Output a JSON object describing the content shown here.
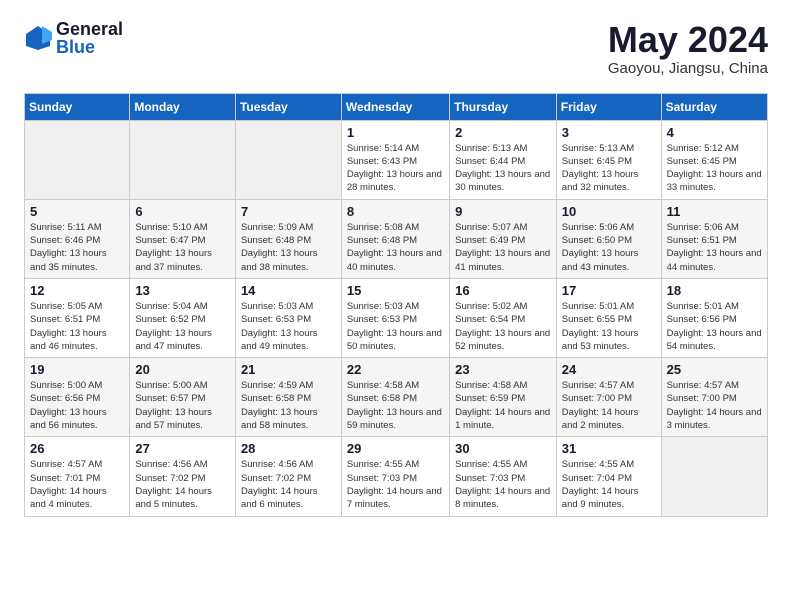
{
  "logo": {
    "general": "General",
    "blue": "Blue"
  },
  "title": "May 2024",
  "location": "Gaoyou, Jiangsu, China",
  "days_of_week": [
    "Sunday",
    "Monday",
    "Tuesday",
    "Wednesday",
    "Thursday",
    "Friday",
    "Saturday"
  ],
  "weeks": [
    [
      {
        "day": "",
        "info": ""
      },
      {
        "day": "",
        "info": ""
      },
      {
        "day": "",
        "info": ""
      },
      {
        "day": "1",
        "info": "Sunrise: 5:14 AM\nSunset: 6:43 PM\nDaylight: 13 hours\nand 28 minutes."
      },
      {
        "day": "2",
        "info": "Sunrise: 5:13 AM\nSunset: 6:44 PM\nDaylight: 13 hours\nand 30 minutes."
      },
      {
        "day": "3",
        "info": "Sunrise: 5:13 AM\nSunset: 6:45 PM\nDaylight: 13 hours\nand 32 minutes."
      },
      {
        "day": "4",
        "info": "Sunrise: 5:12 AM\nSunset: 6:45 PM\nDaylight: 13 hours\nand 33 minutes."
      }
    ],
    [
      {
        "day": "5",
        "info": "Sunrise: 5:11 AM\nSunset: 6:46 PM\nDaylight: 13 hours\nand 35 minutes."
      },
      {
        "day": "6",
        "info": "Sunrise: 5:10 AM\nSunset: 6:47 PM\nDaylight: 13 hours\nand 37 minutes."
      },
      {
        "day": "7",
        "info": "Sunrise: 5:09 AM\nSunset: 6:48 PM\nDaylight: 13 hours\nand 38 minutes."
      },
      {
        "day": "8",
        "info": "Sunrise: 5:08 AM\nSunset: 6:48 PM\nDaylight: 13 hours\nand 40 minutes."
      },
      {
        "day": "9",
        "info": "Sunrise: 5:07 AM\nSunset: 6:49 PM\nDaylight: 13 hours\nand 41 minutes."
      },
      {
        "day": "10",
        "info": "Sunrise: 5:06 AM\nSunset: 6:50 PM\nDaylight: 13 hours\nand 43 minutes."
      },
      {
        "day": "11",
        "info": "Sunrise: 5:06 AM\nSunset: 6:51 PM\nDaylight: 13 hours\nand 44 minutes."
      }
    ],
    [
      {
        "day": "12",
        "info": "Sunrise: 5:05 AM\nSunset: 6:51 PM\nDaylight: 13 hours\nand 46 minutes."
      },
      {
        "day": "13",
        "info": "Sunrise: 5:04 AM\nSunset: 6:52 PM\nDaylight: 13 hours\nand 47 minutes."
      },
      {
        "day": "14",
        "info": "Sunrise: 5:03 AM\nSunset: 6:53 PM\nDaylight: 13 hours\nand 49 minutes."
      },
      {
        "day": "15",
        "info": "Sunrise: 5:03 AM\nSunset: 6:53 PM\nDaylight: 13 hours\nand 50 minutes."
      },
      {
        "day": "16",
        "info": "Sunrise: 5:02 AM\nSunset: 6:54 PM\nDaylight: 13 hours\nand 52 minutes."
      },
      {
        "day": "17",
        "info": "Sunrise: 5:01 AM\nSunset: 6:55 PM\nDaylight: 13 hours\nand 53 minutes."
      },
      {
        "day": "18",
        "info": "Sunrise: 5:01 AM\nSunset: 6:56 PM\nDaylight: 13 hours\nand 54 minutes."
      }
    ],
    [
      {
        "day": "19",
        "info": "Sunrise: 5:00 AM\nSunset: 6:56 PM\nDaylight: 13 hours\nand 56 minutes."
      },
      {
        "day": "20",
        "info": "Sunrise: 5:00 AM\nSunset: 6:57 PM\nDaylight: 13 hours\nand 57 minutes."
      },
      {
        "day": "21",
        "info": "Sunrise: 4:59 AM\nSunset: 6:58 PM\nDaylight: 13 hours\nand 58 minutes."
      },
      {
        "day": "22",
        "info": "Sunrise: 4:58 AM\nSunset: 6:58 PM\nDaylight: 13 hours\nand 59 minutes."
      },
      {
        "day": "23",
        "info": "Sunrise: 4:58 AM\nSunset: 6:59 PM\nDaylight: 14 hours\nand 1 minute."
      },
      {
        "day": "24",
        "info": "Sunrise: 4:57 AM\nSunset: 7:00 PM\nDaylight: 14 hours\nand 2 minutes."
      },
      {
        "day": "25",
        "info": "Sunrise: 4:57 AM\nSunset: 7:00 PM\nDaylight: 14 hours\nand 3 minutes."
      }
    ],
    [
      {
        "day": "26",
        "info": "Sunrise: 4:57 AM\nSunset: 7:01 PM\nDaylight: 14 hours\nand 4 minutes."
      },
      {
        "day": "27",
        "info": "Sunrise: 4:56 AM\nSunset: 7:02 PM\nDaylight: 14 hours\nand 5 minutes."
      },
      {
        "day": "28",
        "info": "Sunrise: 4:56 AM\nSunset: 7:02 PM\nDaylight: 14 hours\nand 6 minutes."
      },
      {
        "day": "29",
        "info": "Sunrise: 4:55 AM\nSunset: 7:03 PM\nDaylight: 14 hours\nand 7 minutes."
      },
      {
        "day": "30",
        "info": "Sunrise: 4:55 AM\nSunset: 7:03 PM\nDaylight: 14 hours\nand 8 minutes."
      },
      {
        "day": "31",
        "info": "Sunrise: 4:55 AM\nSunset: 7:04 PM\nDaylight: 14 hours\nand 9 minutes."
      },
      {
        "day": "",
        "info": ""
      }
    ]
  ]
}
